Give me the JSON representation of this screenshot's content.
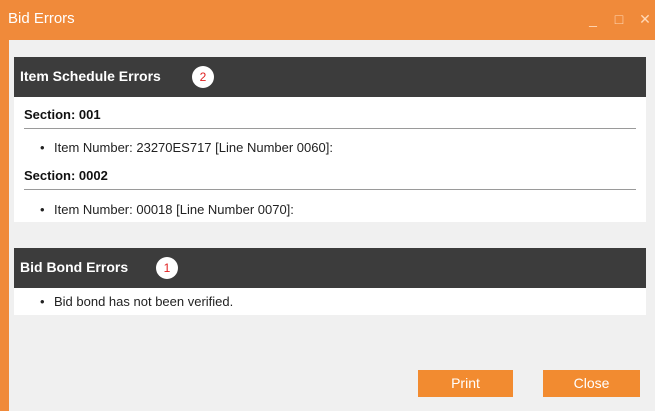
{
  "window": {
    "title": "Bid Errors",
    "minimize_glyph": "_",
    "maximize_glyph": "□",
    "close_glyph": "✕"
  },
  "item_schedule": {
    "title": "Item Schedule Errors",
    "count": "2",
    "sections": [
      {
        "label": "Section: 001",
        "items": [
          "Item Number: 23270ES717 [Line Number 0060]:"
        ]
      },
      {
        "label": "Section: 0002",
        "items": [
          "Item Number: 00018 [Line Number 0070]:"
        ]
      }
    ]
  },
  "bid_bond": {
    "title": "Bid Bond Errors",
    "count": "1",
    "items": [
      "Bid bond has not been verified."
    ]
  },
  "buttons": {
    "print": "Print",
    "close": "Close"
  },
  "colors": {
    "accent": "#f08a3a",
    "header_dark": "#3c3c3c",
    "badge_text": "#e02020"
  }
}
